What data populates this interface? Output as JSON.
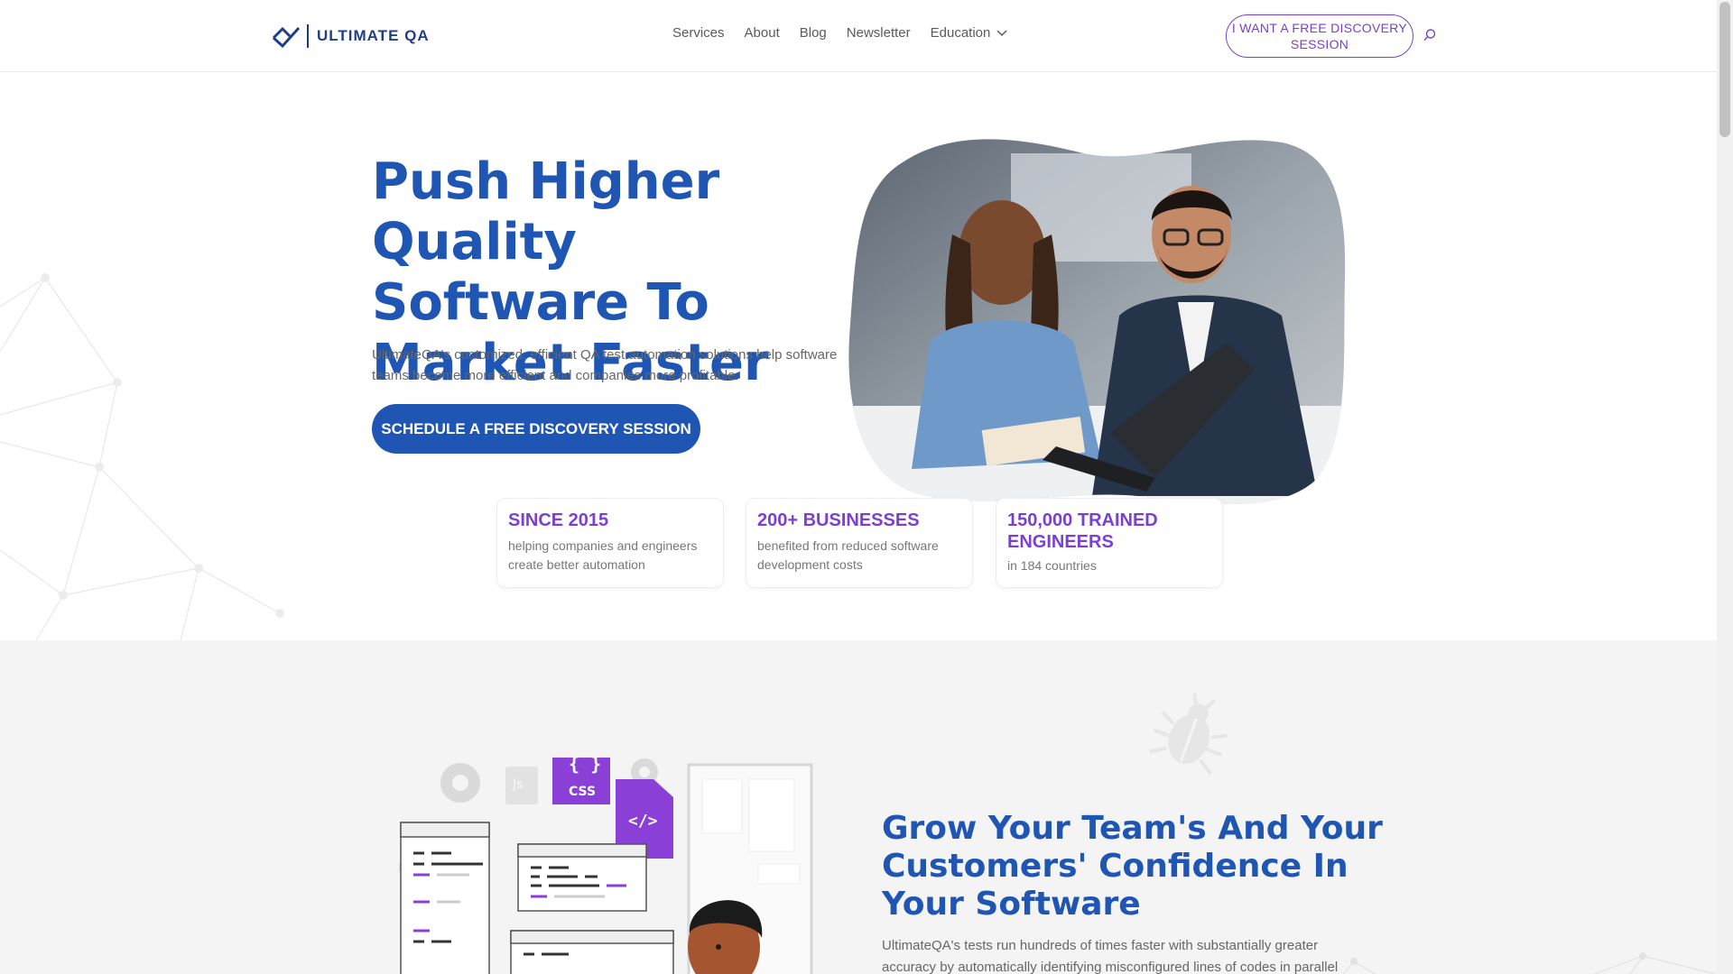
{
  "header": {
    "logo_text": "ULTIMATE QA",
    "nav": [
      "Services",
      "About",
      "Blog",
      "Newsletter",
      "Education"
    ],
    "cta_label": "I WANT A FREE DISCOVERY SESSION",
    "colors": {
      "brand_blue": "#1f55b3",
      "accent_purple": "#7a3fd0"
    }
  },
  "hero": {
    "title": "Push Higher Quality Software To Market Faster",
    "subtitle": "UltimateQA's customized, efficient QA test automation solutions help software teams become more efficient and companies more profitable.",
    "button_label": "SCHEDULE A FREE DISCOVERY SESSION",
    "stats": [
      {
        "title": "SINCE 2015",
        "text": "helping companies and engineers create better automation"
      },
      {
        "title": "200+ BUSINESSES",
        "text": "benefited from reduced software development costs"
      },
      {
        "title": "150,000 TRAINED ENGINEERS",
        "text": "in 184 countries"
      }
    ]
  },
  "section2": {
    "title": "Grow Your Team's And Your Customers' Confidence In Your Software",
    "text": "UltimateQA's tests run hundreds of times faster with substantially greater accuracy by automatically identifying misconfigured lines of codes in parallel",
    "illustration_labels": {
      "css": "CSS",
      "html": "</>",
      "js": "Js"
    }
  }
}
